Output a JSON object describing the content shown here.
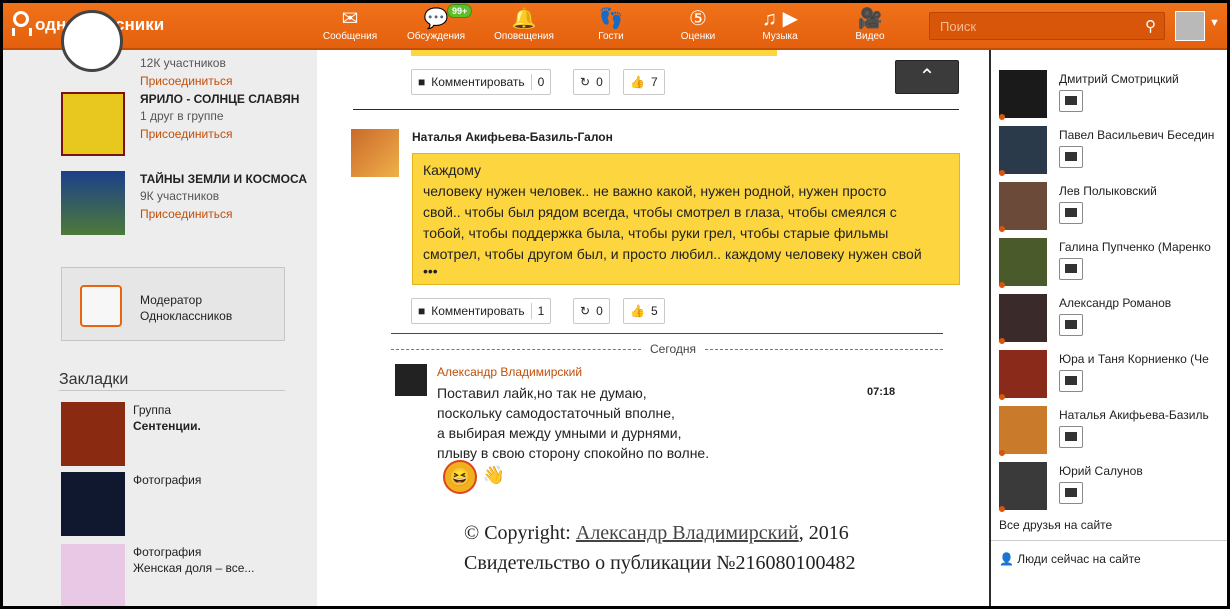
{
  "header": {
    "logo_text": "одноклассники",
    "nav": [
      {
        "label": "Сообщения",
        "icon": "envelope-icon"
      },
      {
        "label": "Обсуждения",
        "icon": "chat-bubbles-icon",
        "badge": "99+"
      },
      {
        "label": "Оповещения",
        "icon": "bell-icon"
      },
      {
        "label": "Гости",
        "icon": "footprints-icon"
      },
      {
        "label": "Оценки",
        "icon": "rating-five-icon"
      },
      {
        "label": "Музыка",
        "icon": "music-note-icon"
      },
      {
        "label": "Видео",
        "icon": "camera-icon"
      }
    ],
    "search_placeholder": "Поиск"
  },
  "left": {
    "groups": [
      {
        "title": "",
        "meta": "12К участников",
        "join": "Присоединиться"
      },
      {
        "title": "ЯРИЛО - СОЛНЦЕ СЛАВЯН",
        "meta": "1 друг в группе",
        "join": "Присоединиться"
      },
      {
        "title": "ТАЙНЫ ЗЕМЛИ И КОСМОСА",
        "meta": "9К участников",
        "join": "Присоединиться"
      }
    ],
    "moderator": {
      "line1": "Модератор",
      "line2": "Одноклассников"
    },
    "bookmarks_title": "Закладки",
    "bookmarks": [
      {
        "type": "Группа",
        "name": "Сентенции."
      },
      {
        "type": "Фотография",
        "name": ""
      },
      {
        "type": "Фотография",
        "name": "Женская доля – все..."
      }
    ]
  },
  "feed": {
    "comment_label": "Комментировать",
    "post1": {
      "comments": "0",
      "shares": "0",
      "likes": "7"
    },
    "post2": {
      "author": "Наталья Акифьева-Базиль-Галон",
      "text_lines": [
        "Каждому",
        " человеку нужен человек.. не важно какой, нужен родной, нужен просто",
        "свой.. чтобы был рядом всегда, чтобы смотрел в глаза, чтобы смеялся с",
        "тобой, чтобы поддержка была, чтобы руки грел, чтобы старые фильмы",
        "смотрел, чтобы другом был, и просто любил.. каждому человеку нужен свой",
        "•••"
      ],
      "comments": "1",
      "shares": "0",
      "likes": "5"
    },
    "today_label": "Сегодня",
    "comment": {
      "author": "Александр Владимирский",
      "time": "07:18",
      "lines": [
        "Поставил лайк,но так не думаю,",
        "поскольку самодостаточный вполне,",
        "а выбирая между умными и дурнями,",
        "плыву в свою сторону спокойно по волне."
      ]
    },
    "copyright": {
      "prefix": "© Copyright: ",
      "author": "Александр Владимирский",
      "year": ", 2016",
      "certificate": "Свидетельство о публикации №216080100482"
    }
  },
  "friends": {
    "list": [
      "Дмитрий Смотрицкий",
      "Павел Васильевич Беседин",
      "Лев Полыковский",
      "Галина Пупченко (Маренко",
      "Александр Романов",
      "Юра и Таня Корниенко (Че",
      "Наталья Акифьева-Базиль",
      "Юрий Салунов"
    ],
    "all_label": "Все друзья на сайте",
    "people_label": "Люди сейчас на сайте"
  },
  "colors": {
    "brand": "#ee6d14",
    "post_bg": "#fcd53f",
    "link": "#c24e09"
  }
}
